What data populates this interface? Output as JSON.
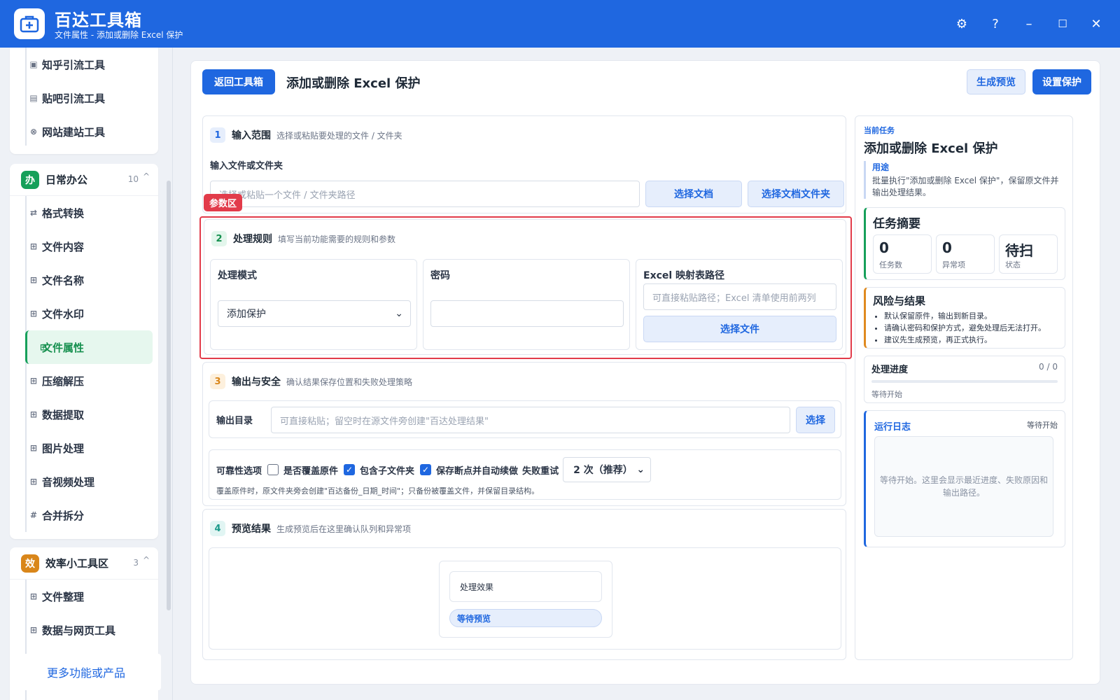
{
  "app": {
    "title": "百达工具箱",
    "subtitle": "文件属性 - 添加或删除 Excel 保护"
  },
  "window": {
    "settings": "⚙",
    "help": "?",
    "minimize": "–",
    "maximize": "☐",
    "close": "✕"
  },
  "sidebar": {
    "top_items": [
      {
        "label": "知乎引流工具"
      },
      {
        "label": "贴吧引流工具"
      },
      {
        "label": "网站建站工具"
      }
    ],
    "group1": {
      "badge": "办",
      "title": "日常办公",
      "count": "10",
      "caret": "^",
      "items": [
        {
          "label": "格式转换",
          "icon": "⇄"
        },
        {
          "label": "文件内容",
          "icon": "⊞"
        },
        {
          "label": "文件名称",
          "icon": "⊞"
        },
        {
          "label": "文件水印",
          "icon": "⊞"
        },
        {
          "label": "文件属性",
          "icon": "⊞"
        },
        {
          "label": "压缩解压",
          "icon": "⊞"
        },
        {
          "label": "数据提取",
          "icon": "⊞"
        },
        {
          "label": "图片处理",
          "icon": "⊞"
        },
        {
          "label": "音视频处理",
          "icon": "⊞"
        },
        {
          "label": "合并拆分",
          "icon": "#"
        }
      ]
    },
    "group2": {
      "badge": "效",
      "title": "效率小工具区",
      "count": "3",
      "caret": "^",
      "items": [
        {
          "label": "文件整理"
        },
        {
          "label": "数据与网页工具"
        }
      ]
    },
    "more": "更多功能或产品"
  },
  "toolbar": {
    "back": "返回工具箱",
    "title": "添加或删除 Excel 保护",
    "preview": "生成预览",
    "apply": "设置保护"
  },
  "sec1": {
    "num": "1",
    "title": "输入范围",
    "desc": "选择或粘贴要处理的文件 / 文件夹",
    "field_label": "输入文件或文件夹",
    "placeholder": "选择或粘贴一个文件 / 文件夹路径",
    "btn_doc": "选择文档",
    "btn_folder": "选择文档文件夹"
  },
  "tag_param": "参数区",
  "sec2": {
    "num": "2",
    "title": "处理规则",
    "desc": "填写当前功能需要的规则和参数",
    "mode_label": "处理模式",
    "mode_value": "添加保护",
    "pwd_label": "密码",
    "map_label": "Excel 映射表路径",
    "map_placeholder": "可直接粘贴路径；Excel 清单使用前两列",
    "map_btn": "选择文件"
  },
  "sec3": {
    "num": "3",
    "title": "输出与安全",
    "desc": "确认结果保存位置和失败处理策略",
    "out_label": "输出目录",
    "out_placeholder": "可直接粘贴；留空时在源文件旁创建\"百达处理结果\"",
    "out_btn": "选择",
    "opt_label": "可靠性选项",
    "opt_overwrite": "是否覆盖原件",
    "opt_sub": "包含子文件夹",
    "opt_resume": "保存断点并自动续做",
    "retry_label": "失败重试",
    "retry_value": "2 次（推荐）",
    "note": "覆盖原件时，原文件夹旁会创建\"百达备份_日期_时间\"；只备份被覆盖文件，并保留目录结构。"
  },
  "sec4": {
    "num": "4",
    "title": "预览结果",
    "desc": "生成预览后在这里确认队列和异常项",
    "effect": "处理效果",
    "waiting": "等待预览"
  },
  "right": {
    "cur_label": "当前任务",
    "cur_title": "添加或删除 Excel 保护",
    "use_label": "用途",
    "use_text": "批量执行\"添加或删除 Excel 保护\"，保留原文件并输出处理结果。",
    "summary_title": "任务摘要",
    "stats": [
      {
        "value": "0",
        "label": "任务数"
      },
      {
        "value": "0",
        "label": "异常项"
      },
      {
        "value": "待扫",
        "label": "状态"
      }
    ],
    "risk_title": "风险与结果",
    "risks": [
      "默认保留原件，输出到新目录。",
      "请确认密码和保护方式，避免处理后无法打开。",
      "建议先生成预览，再正式执行。"
    ],
    "progress_title": "处理进度",
    "progress_count": "0 / 0",
    "progress_status": "等待开始",
    "progress_fraction": 0,
    "log_title": "运行日志",
    "log_status": "等待开始",
    "log_text": "等待开始。这里会显示最近进度、失败原因和输出路径。"
  },
  "colors": {
    "accent": "#1f67e0",
    "green": "#16a05a",
    "orange": "#e08a1f",
    "red": "#e23b4a"
  }
}
